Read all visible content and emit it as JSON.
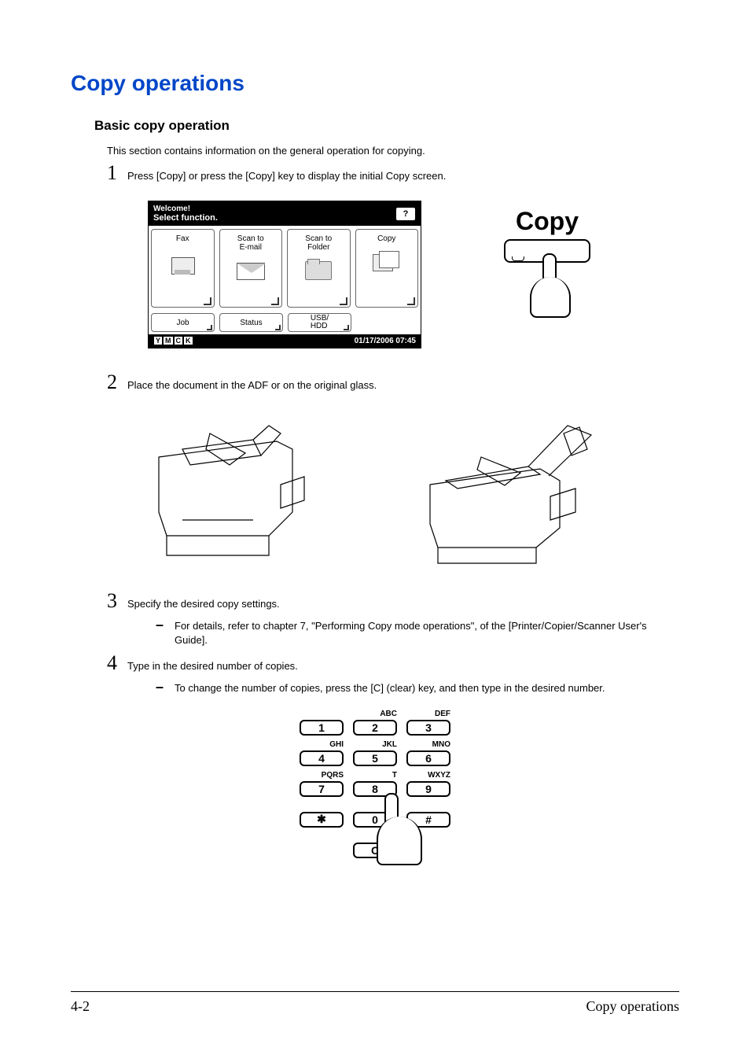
{
  "heading": "Copy operations",
  "subheading": "Basic copy operation",
  "intro_text": "This section contains information on the general operation for copying.",
  "steps": {
    "s1": {
      "num": "1",
      "text": "Press [Copy] or press the [Copy] key to display the initial Copy screen."
    },
    "s2": {
      "num": "2",
      "text": "Place the document in the ADF or on the original glass."
    },
    "s3": {
      "num": "3",
      "text": "Specify the desired copy settings."
    },
    "s3_sub": "For details, refer to chapter 7, \"Performing Copy mode operations\", of the [Printer/Copier/Scanner User's Guide].",
    "s4": {
      "num": "4",
      "text": "Type in the desired number of copies."
    },
    "s4_sub": "To change the number of copies, press the [C] (clear) key, and then type in the desired number."
  },
  "lcd": {
    "welcome": "Welcome!",
    "select_function": "Select function.",
    "help": "?",
    "fax": "Fax",
    "scan_email": "Scan to\nE-mail",
    "scan_folder": "Scan to\nFolder",
    "copy": "Copy",
    "job": "Job",
    "status": "Status",
    "usb_hdd": "USB/\nHDD",
    "toner": {
      "y": "Y",
      "m": "M",
      "c": "C",
      "k": "K"
    },
    "datetime": "01/17/2006 07:45"
  },
  "hw_button": {
    "label": "Copy"
  },
  "keypad": {
    "r1": {
      "k1": "1",
      "l2": "ABC",
      "k2": "2",
      "l3": "DEF",
      "k3": "3"
    },
    "r2": {
      "l1": "GHI",
      "k1": "4",
      "l2": "JKL",
      "k2": "5",
      "l3": "MNO",
      "k3": "6"
    },
    "r3": {
      "l1": "PQRS",
      "k1": "7",
      "l2": "T",
      "k2": "8",
      "l3": "WXYZ",
      "k3": "9"
    },
    "r4": {
      "k1": "✱",
      "k2": "0",
      "k3": "#"
    },
    "clear": "C"
  },
  "footer": {
    "page": "4-2",
    "title": "Copy operations"
  }
}
